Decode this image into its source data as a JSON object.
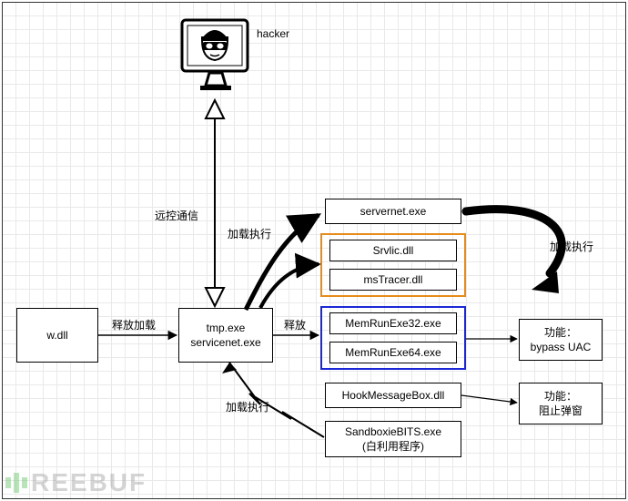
{
  "top": {
    "hacker_label": "hacker"
  },
  "left": {
    "wdll": "w.dll",
    "release_load": "释放加载"
  },
  "center": {
    "tmp_line1": "tmp.exe",
    "tmp_line2": "servicenet.exe",
    "remote_comm": "远控通信",
    "load_exec_top": "加载执行",
    "release": "释放",
    "load_exec_bottom": "加载执行"
  },
  "right": {
    "load_exec_cycle": "加载执行",
    "servernet": "servernet.exe",
    "srvlic": "Srvlic.dll",
    "mstracer": "msTracer.dll",
    "memrun32": "MemRunExe32.exe",
    "memrun64": "MemRunExe64.exe",
    "hookmsg": "HookMessageBox.dll",
    "sandboxie_line1": "SandboxieBITS.exe",
    "sandboxie_line2": "(白利用程序)"
  },
  "func": {
    "heading1": "功能：",
    "bypass": "bypass UAC",
    "heading2": "功能：",
    "block_popup": "阻止弹窗"
  },
  "watermark": "REEBUF"
}
